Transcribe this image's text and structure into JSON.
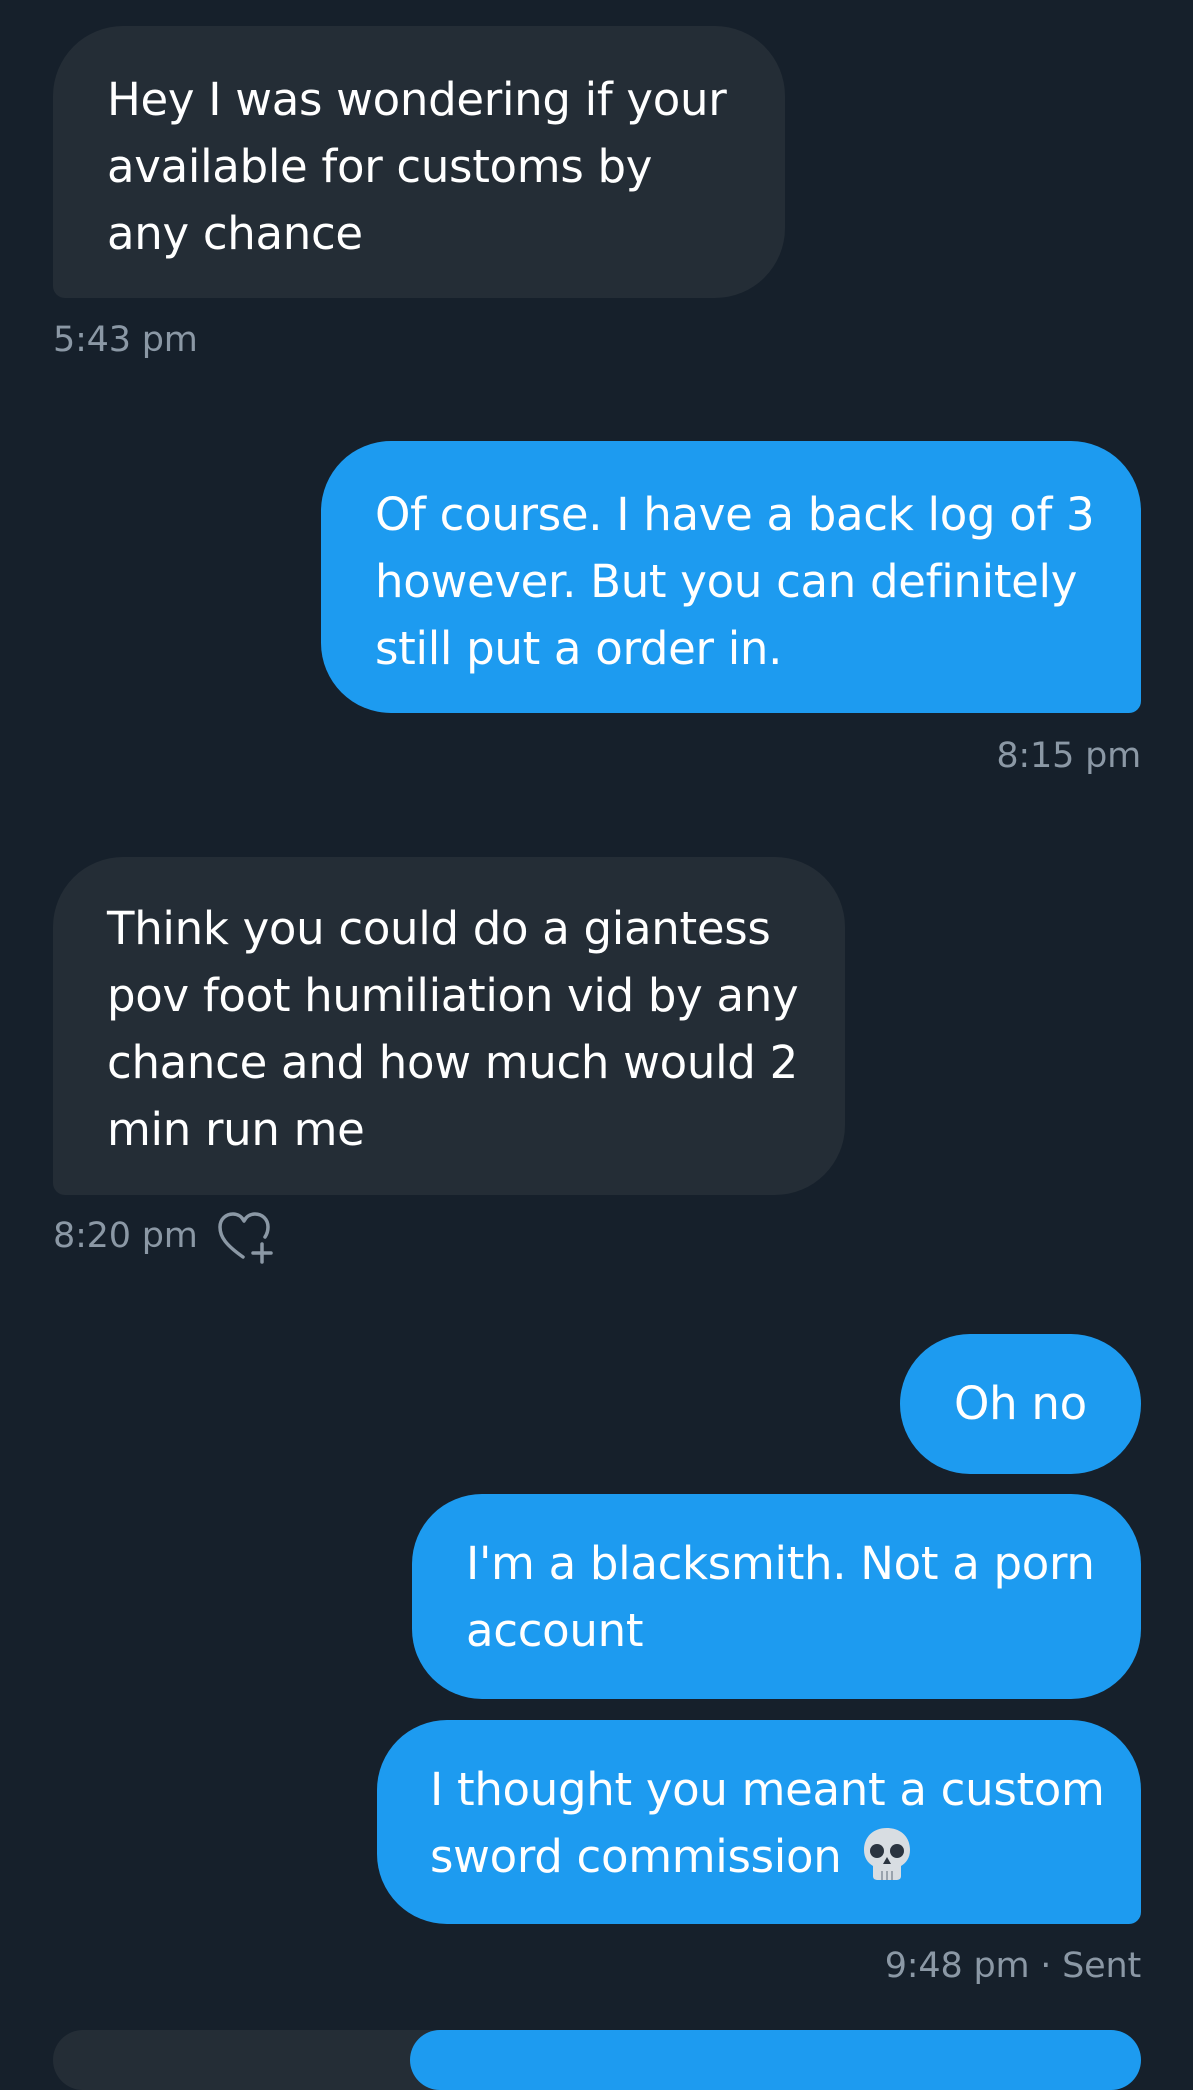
{
  "colors": {
    "background": "#16202b",
    "incoming_bubble": "#242d36",
    "outgoing_bubble": "#1d9bf0",
    "meta_text": "#8b98a5"
  },
  "messages": [
    {
      "direction": "incoming",
      "text": "Hey I was wondering if your available for customs by any chance",
      "time": "5:43 pm"
    },
    {
      "direction": "outgoing",
      "text": "Of course. I have a back log of 3 however. But you can definitely still put a order in.",
      "time": "8:15 pm"
    },
    {
      "direction": "incoming",
      "text": "Think you could do a giantess pov foot humiliation vid by any chance and how much would 2 min run me",
      "time": "8:20 pm",
      "reaction_icon": "heart-plus-icon"
    },
    {
      "direction": "outgoing",
      "text": "Oh no"
    },
    {
      "direction": "outgoing",
      "text": "I'm a blacksmith. Not a porn account"
    },
    {
      "direction": "outgoing",
      "text": "I thought you meant a custom sword commission",
      "emoji": "skull-icon",
      "time": "9:48 pm · Sent"
    }
  ]
}
